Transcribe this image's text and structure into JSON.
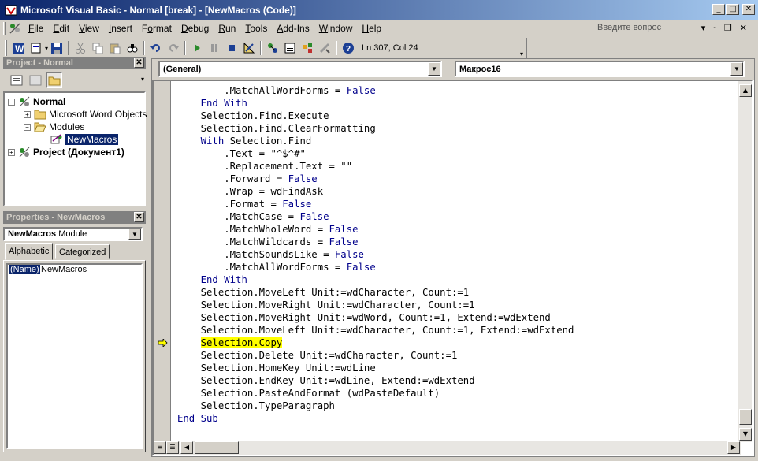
{
  "window": {
    "title": "Microsoft Visual Basic - Normal [break] - [NewMacros (Code)]",
    "controls": {
      "minimize": "_",
      "maximize": "□",
      "close": "✕"
    }
  },
  "menu": {
    "items": [
      "File",
      "Edit",
      "View",
      "Insert",
      "Format",
      "Debug",
      "Run",
      "Tools",
      "Add-Ins",
      "Window",
      "Help"
    ],
    "underline": [
      "F",
      "E",
      "V",
      "I",
      "o",
      "D",
      "R",
      "T",
      "A",
      "W",
      "H"
    ],
    "ask_placeholder": "Введите вопрос",
    "mdi_controls": {
      "minimize": "-",
      "restore": "❐",
      "close": "✕"
    }
  },
  "toolbar": {
    "position": "Ln 307, Col 24",
    "icons": [
      "word-icon",
      "insert-module-icon",
      "save-icon",
      "cut-icon",
      "copy-icon",
      "paste-icon",
      "find-icon",
      "undo-icon",
      "redo-icon",
      "run-icon",
      "break-icon",
      "reset-icon",
      "design-mode-icon",
      "project-explorer-icon",
      "properties-icon",
      "object-browser-icon",
      "toolbox-icon",
      "help-icon"
    ]
  },
  "project": {
    "title": "Project - Normal",
    "tree": {
      "normal": "Normal",
      "word_objects": "Microsoft Word Objects",
      "modules": "Modules",
      "newmacros": "NewMacros",
      "project_doc": "Project (Документ1)"
    }
  },
  "properties": {
    "title": "Properties - NewMacros",
    "object_name": "NewMacros",
    "object_type": "Module",
    "tabs": [
      "Alphabetic",
      "Categorized"
    ],
    "rows": [
      {
        "name": "(Name)",
        "value": "NewMacros"
      }
    ]
  },
  "code": {
    "object_combo": "(General)",
    "proc_combo": "Макрос16",
    "current_line_index": 20,
    "lines": [
      "        .MatchAllWordForms = False",
      "    End With",
      "    Selection.Find.Execute",
      "    Selection.Find.ClearFormatting",
      "    With Selection.Find",
      "        .Text = \"^$^#\"",
      "        .Replacement.Text = \"\"",
      "        .Forward = False",
      "        .Wrap = wdFindAsk",
      "        .Format = False",
      "        .MatchCase = False",
      "        .MatchWholeWord = False",
      "        .MatchWildcards = False",
      "        .MatchSoundsLike = False",
      "        .MatchAllWordForms = False",
      "    End With",
      "    Selection.MoveLeft Unit:=wdCharacter, Count:=1",
      "    Selection.MoveRight Unit:=wdCharacter, Count:=1",
      "    Selection.MoveRight Unit:=wdWord, Count:=1, Extend:=wdExtend",
      "    Selection.MoveLeft Unit:=wdCharacter, Count:=1, Extend:=wdExtend",
      "    Selection.Copy",
      "    Selection.Delete Unit:=wdCharacter, Count:=1",
      "    Selection.HomeKey Unit:=wdLine",
      "    Selection.EndKey Unit:=wdLine, Extend:=wdExtend",
      "    Selection.PasteAndFormat (wdPasteDefault)",
      "    Selection.TypeParagraph",
      "End Sub"
    ],
    "keywords": [
      "End With",
      "With",
      "False",
      "End Sub"
    ]
  },
  "colors": {
    "keyword": "#00008b",
    "highlight": "#ffff00",
    "title_start": "#0a246a",
    "title_end": "#a6caf0"
  }
}
